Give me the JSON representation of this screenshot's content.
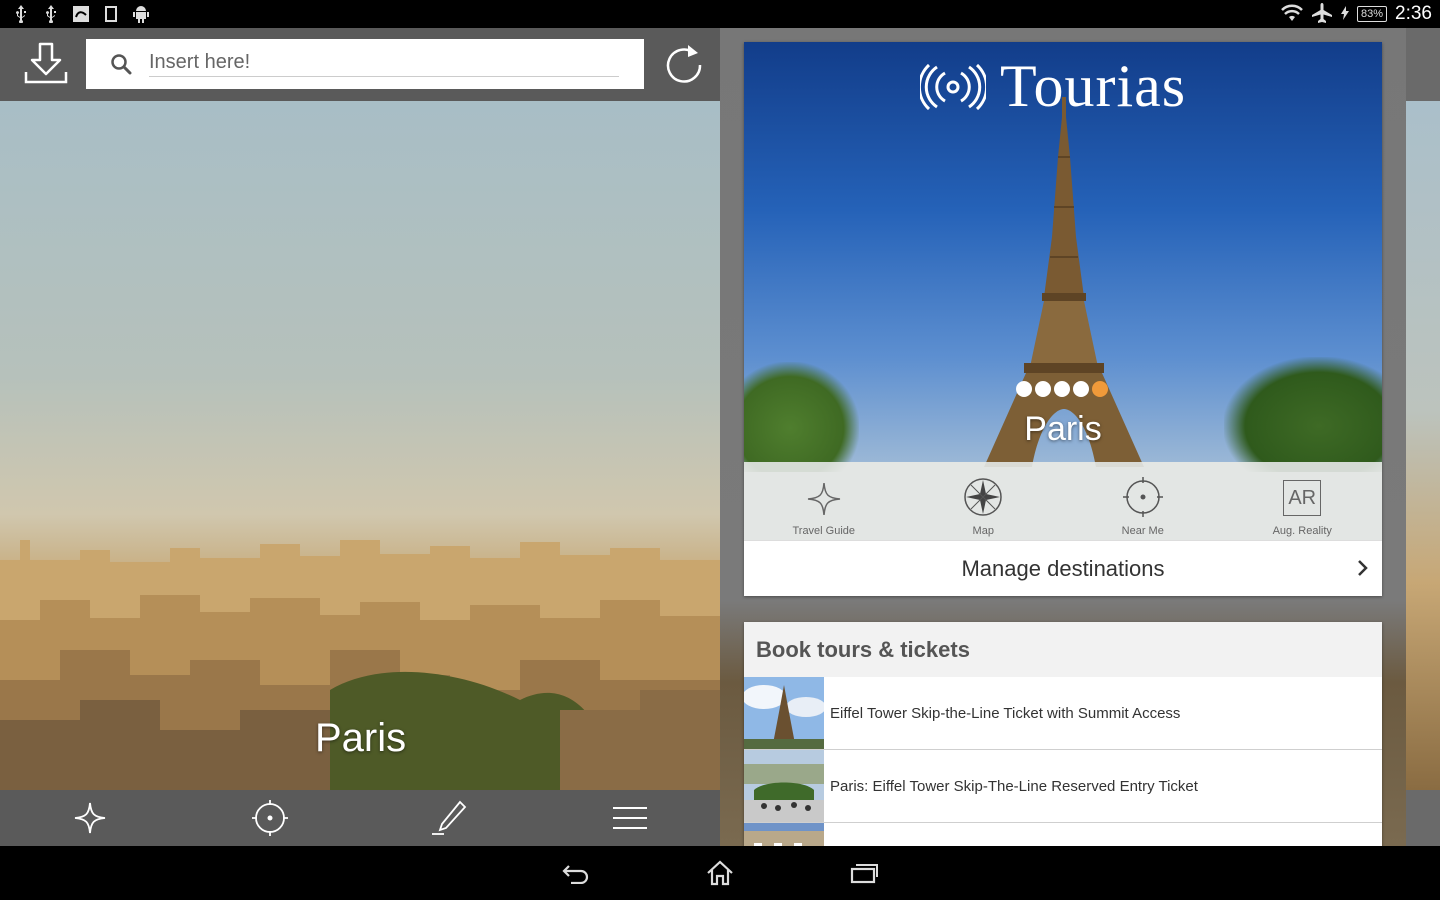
{
  "status_bar": {
    "left_icons": [
      "usb-icon",
      "usb-debug-icon",
      "app-notification-icon",
      "screen-icon",
      "android-icon"
    ],
    "battery": "83%",
    "time": "2:36"
  },
  "search": {
    "placeholder": "Insert here!"
  },
  "left_pane": {
    "city": "Paris",
    "bottom_tabs": [
      "star-icon",
      "target-icon",
      "pen-icon",
      "menu-icon"
    ]
  },
  "brand": {
    "name": "Tourias"
  },
  "hero": {
    "city": "Paris",
    "dots_total": 5,
    "dots_active_index": 4
  },
  "nav_items": [
    {
      "label": "Travel Guide",
      "icon": "star-icon"
    },
    {
      "label": "Map",
      "icon": "compass-icon"
    },
    {
      "label": "Near Me",
      "icon": "target-icon"
    },
    {
      "label": "Aug. Reality",
      "icon": "ar-icon",
      "badge": "AR"
    }
  ],
  "manage": {
    "label": "Manage destinations"
  },
  "book": {
    "header": "Book tours & tickets",
    "items": [
      {
        "title": "Eiffel Tower Skip-the-Line Ticket with Summit Access"
      },
      {
        "title": "Paris: Eiffel Tower Skip-The-Line Reserved Entry Ticket"
      },
      {
        "title": ""
      }
    ]
  },
  "colors": {
    "toolbar": "#5a5a5a",
    "accent_dot": "#f09a3a",
    "sky": "#2562b8"
  }
}
